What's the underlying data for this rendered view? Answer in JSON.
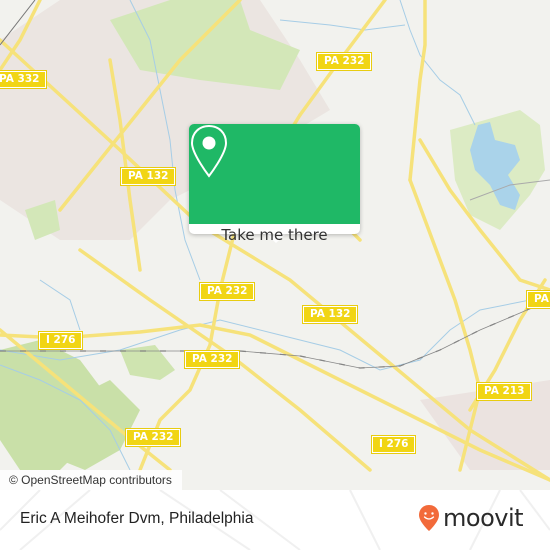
{
  "map": {
    "attribution": "© OpenStreetMap contributors",
    "road_labels": [
      {
        "id": "pa332",
        "text": "PA 332"
      },
      {
        "id": "pa232-top",
        "text": "PA 232"
      },
      {
        "id": "pa132-left",
        "text": "PA 132"
      },
      {
        "id": "pa232-mid",
        "text": "PA 232"
      },
      {
        "id": "pa132-mid",
        "text": "PA 132"
      },
      {
        "id": "i276-left",
        "text": "I 276"
      },
      {
        "id": "pa232-rail",
        "text": "PA 232"
      },
      {
        "id": "pa232-bottom",
        "text": "PA 232"
      },
      {
        "id": "i276-right",
        "text": "I 276"
      },
      {
        "id": "pa213",
        "text": "PA 213"
      },
      {
        "id": "pa-right",
        "text": "PA"
      }
    ],
    "colors": {
      "land": "#f2f2ee",
      "road": "#f6e27a",
      "shield": "#f1d514",
      "park": "#cfe4b0",
      "water": "#aad3ea",
      "urban": "#e9e3df",
      "rail": "#777777"
    }
  },
  "popup": {
    "icon": "map-pin-icon",
    "button_label": "Take me there",
    "color": "#1fb866"
  },
  "footer": {
    "place_title": "Eric A Meihofer Dvm, Philadelphia",
    "brand_name": "moovit",
    "brand_icon": "moovit-smiley-pin-icon",
    "brand_color": "#f26a3a"
  }
}
